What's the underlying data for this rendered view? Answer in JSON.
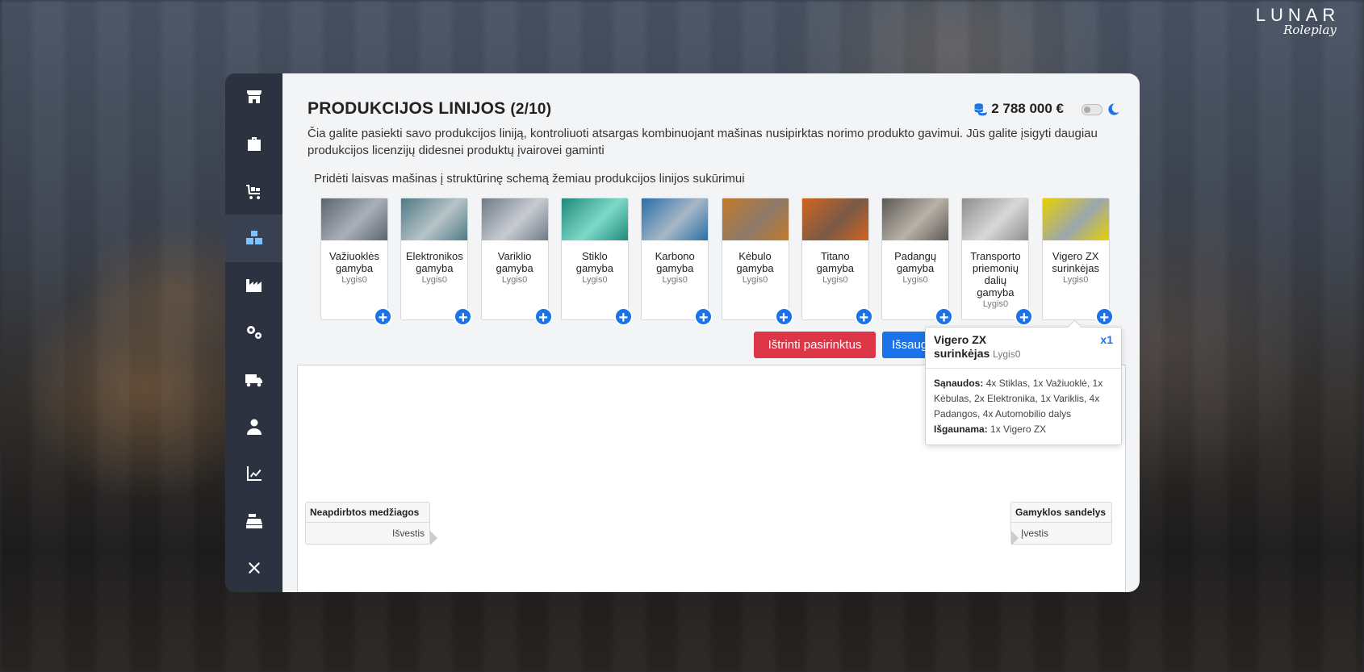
{
  "brand": {
    "name": "LUNAR",
    "tagline": "Roleplay"
  },
  "sidebar": {
    "items": [
      {
        "icon": "store-icon",
        "active": false
      },
      {
        "icon": "briefcase-icon",
        "active": false
      },
      {
        "icon": "cart-icon",
        "active": false
      },
      {
        "icon": "boxes-icon",
        "active": true
      },
      {
        "icon": "factory-icon",
        "active": false
      },
      {
        "icon": "gears-icon",
        "active": false
      },
      {
        "icon": "truck-icon",
        "active": false
      },
      {
        "icon": "user-tie-icon",
        "active": false
      },
      {
        "icon": "chart-line-icon",
        "active": false
      },
      {
        "icon": "cash-register-icon",
        "active": false
      },
      {
        "icon": "close-icon",
        "active": false
      }
    ]
  },
  "header": {
    "title": "PRODUKCIJOS LINIJOS",
    "count": "(2/10)",
    "balance": "2 788 000 €",
    "description": "Čia galite pasiekti savo produkcijos liniją, kontroliuoti atsargas kombinuojant mašinas nusipirktas norimo produkto gavimui. Jūs galite įsigyti daugiau produkcijos licenzijų didesnei produktų įvairovei gaminti",
    "subtitle": "Pridėti laisvas mašinas į struktūrinę schemą žemiau produkcijos linijos sukūrimui"
  },
  "machines": [
    {
      "name": "Važiuoklės gamyba",
      "level": "Lygis0",
      "colors": [
        "#5b6470",
        "#a9b0b8"
      ]
    },
    {
      "name": "Elektronikos gamyba",
      "level": "Lygis0",
      "colors": [
        "#4f7a86",
        "#b6c4c7"
      ]
    },
    {
      "name": "Variklio gamyba",
      "level": "Lygis0",
      "colors": [
        "#6f7a86",
        "#c8ccd2"
      ]
    },
    {
      "name": "Stiklo gamyba",
      "level": "Lygis0",
      "colors": [
        "#1f8a7a",
        "#7ed9c8"
      ]
    },
    {
      "name": "Karbono gamyba",
      "level": "Lygis0",
      "colors": [
        "#2a6fa8",
        "#a7b7c6"
      ]
    },
    {
      "name": "Kėbulo gamyba",
      "level": "Lygis0",
      "colors": [
        "#c47a2a",
        "#8c7a6a"
      ]
    },
    {
      "name": "Titano gamyba",
      "level": "Lygis0",
      "colors": [
        "#d2641e",
        "#7a5a48"
      ]
    },
    {
      "name": "Padangų gamyba",
      "level": "Lygis0",
      "colors": [
        "#5d5a55",
        "#b8b2a8"
      ]
    },
    {
      "name": "Transporto priemonių dalių gamyba",
      "level": "Lygis0",
      "colors": [
        "#8e8e8e",
        "#d8d8d8"
      ]
    },
    {
      "name": "Vigero ZX surinkėjas",
      "level": "Lygis0",
      "colors": [
        "#e8d000",
        "#9aa7b0"
      ]
    }
  ],
  "buttons": {
    "delete": "Ištrinti pasirinktus",
    "save": "Išsaugoti"
  },
  "canvas": {
    "source_node": {
      "title": "Neapdirbtos medžiagos",
      "port": "Išvestis"
    },
    "target_node": {
      "title": "Gamyklos sandelys",
      "port": "Įvestis"
    }
  },
  "tooltip": {
    "title": "Vigero ZX surinkėjas",
    "level": "Lygis0",
    "multiplier": "x1",
    "consumes_label": "Sąnaudos:",
    "consumes": "4x Stiklas, 1x Važiuoklė, 1x Kėbulas, 2x Elektronika, 1x Variklis, 4x Padangos, 4x Automobilio dalys",
    "produces_label": "Išgaunama:",
    "produces": "1x Vigero ZX"
  }
}
